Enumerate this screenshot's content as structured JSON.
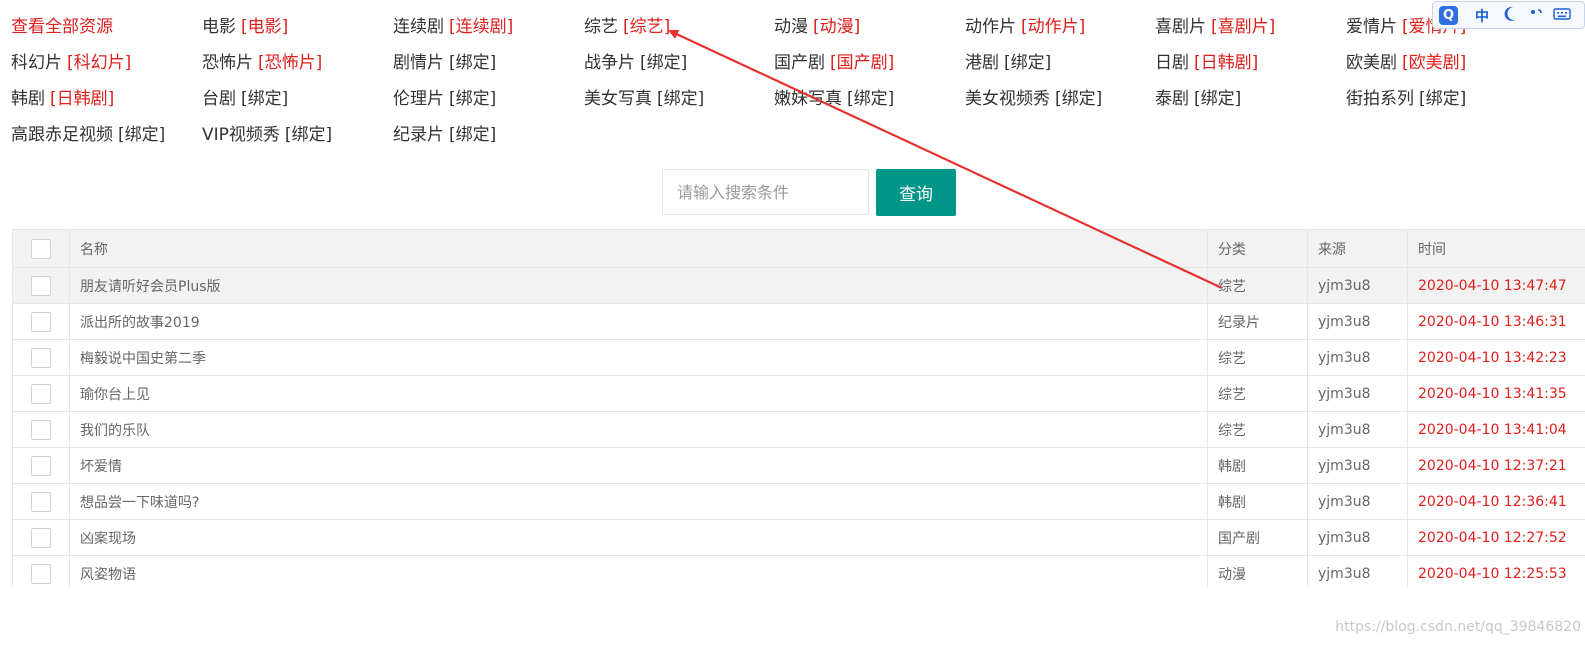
{
  "categories": [
    {
      "name": "查看全部资源",
      "tag": "",
      "tag_highlight": false,
      "name_highlight": true
    },
    {
      "name": "电影",
      "tag": "[电影]",
      "tag_highlight": true
    },
    {
      "name": "连续剧",
      "tag": "[连续剧]",
      "tag_highlight": true
    },
    {
      "name": "综艺",
      "tag": "[综艺]",
      "tag_highlight": true
    },
    {
      "name": "动漫",
      "tag": "[动漫]",
      "tag_highlight": true
    },
    {
      "name": "动作片",
      "tag": "[动作片]",
      "tag_highlight": true
    },
    {
      "name": "喜剧片",
      "tag": "[喜剧片]",
      "tag_highlight": true
    },
    {
      "name": "爱情片",
      "tag": "[爱情片]",
      "tag_highlight": true
    },
    {
      "name": "科幻片",
      "tag": "[科幻片]",
      "tag_highlight": true
    },
    {
      "name": "恐怖片",
      "tag": "[恐怖片]",
      "tag_highlight": true
    },
    {
      "name": "剧情片",
      "tag": "[绑定]",
      "tag_highlight": false
    },
    {
      "name": "战争片",
      "tag": "[绑定]",
      "tag_highlight": false
    },
    {
      "name": "国产剧",
      "tag": "[国产剧]",
      "tag_highlight": true
    },
    {
      "name": "港剧",
      "tag": "[绑定]",
      "tag_highlight": false
    },
    {
      "name": "日剧",
      "tag": "[日韩剧]",
      "tag_highlight": true
    },
    {
      "name": "欧美剧",
      "tag": "[欧美剧]",
      "tag_highlight": true
    },
    {
      "name": "韩剧",
      "tag": "[日韩剧]",
      "tag_highlight": true
    },
    {
      "name": "台剧",
      "tag": "[绑定]",
      "tag_highlight": false
    },
    {
      "name": "伦理片",
      "tag": "[绑定]",
      "tag_highlight": false
    },
    {
      "name": "美女写真",
      "tag": "[绑定]",
      "tag_highlight": false
    },
    {
      "name": "嫩妹写真",
      "tag": "[绑定]",
      "tag_highlight": false
    },
    {
      "name": "美女视频秀",
      "tag": "[绑定]",
      "tag_highlight": false
    },
    {
      "name": "泰剧",
      "tag": "[绑定]",
      "tag_highlight": false
    },
    {
      "name": "街拍系列",
      "tag": "[绑定]",
      "tag_highlight": false
    },
    {
      "name": "高跟赤足视频",
      "tag": "[绑定]",
      "tag_highlight": false
    },
    {
      "name": "VIP视频秀",
      "tag": "[绑定]",
      "tag_highlight": false
    },
    {
      "name": "纪录片",
      "tag": "[绑定]",
      "tag_highlight": false
    }
  ],
  "search": {
    "placeholder": "请输入搜索条件",
    "value": "",
    "button_label": "查询",
    "button_color": "#009688"
  },
  "table": {
    "headers": {
      "name": "名称",
      "category": "分类",
      "source": "来源",
      "time": "时间"
    },
    "rows": [
      {
        "name": "朋友请听好会员Plus版",
        "category": "综艺",
        "source": "yjm3u8",
        "time": "2020-04-10 13:47:47",
        "highlighted": true
      },
      {
        "name": "派出所的故事2019",
        "category": "纪录片",
        "source": "yjm3u8",
        "time": "2020-04-10 13:46:31"
      },
      {
        "name": "梅毅说中国史第二季",
        "category": "综艺",
        "source": "yjm3u8",
        "time": "2020-04-10 13:42:23"
      },
      {
        "name": "瑜你台上见",
        "category": "综艺",
        "source": "yjm3u8",
        "time": "2020-04-10 13:41:35"
      },
      {
        "name": "我们的乐队",
        "category": "综艺",
        "source": "yjm3u8",
        "time": "2020-04-10 13:41:04"
      },
      {
        "name": "坏爱情",
        "category": "韩剧",
        "source": "yjm3u8",
        "time": "2020-04-10 12:37:21"
      },
      {
        "name": "想品尝一下味道吗?",
        "category": "韩剧",
        "source": "yjm3u8",
        "time": "2020-04-10 12:36:41"
      },
      {
        "name": "凶案现场",
        "category": "国产剧",
        "source": "yjm3u8",
        "time": "2020-04-10 12:27:52"
      },
      {
        "name": "风姿物语",
        "category": "动漫",
        "source": "yjm3u8",
        "time": "2020-04-10 12:25:53"
      }
    ]
  },
  "ime_toolbar": {
    "logo": "Q",
    "mode": "中",
    "icons": [
      "moon-icon",
      "punctuation-icon",
      "keyboard-icon"
    ]
  },
  "colors": {
    "highlight_red": "#e0201c",
    "annotation_arrow": "#e53030",
    "header_bg": "#f2f2f2"
  },
  "watermark": "https://blog.csdn.net/qq_39846820"
}
